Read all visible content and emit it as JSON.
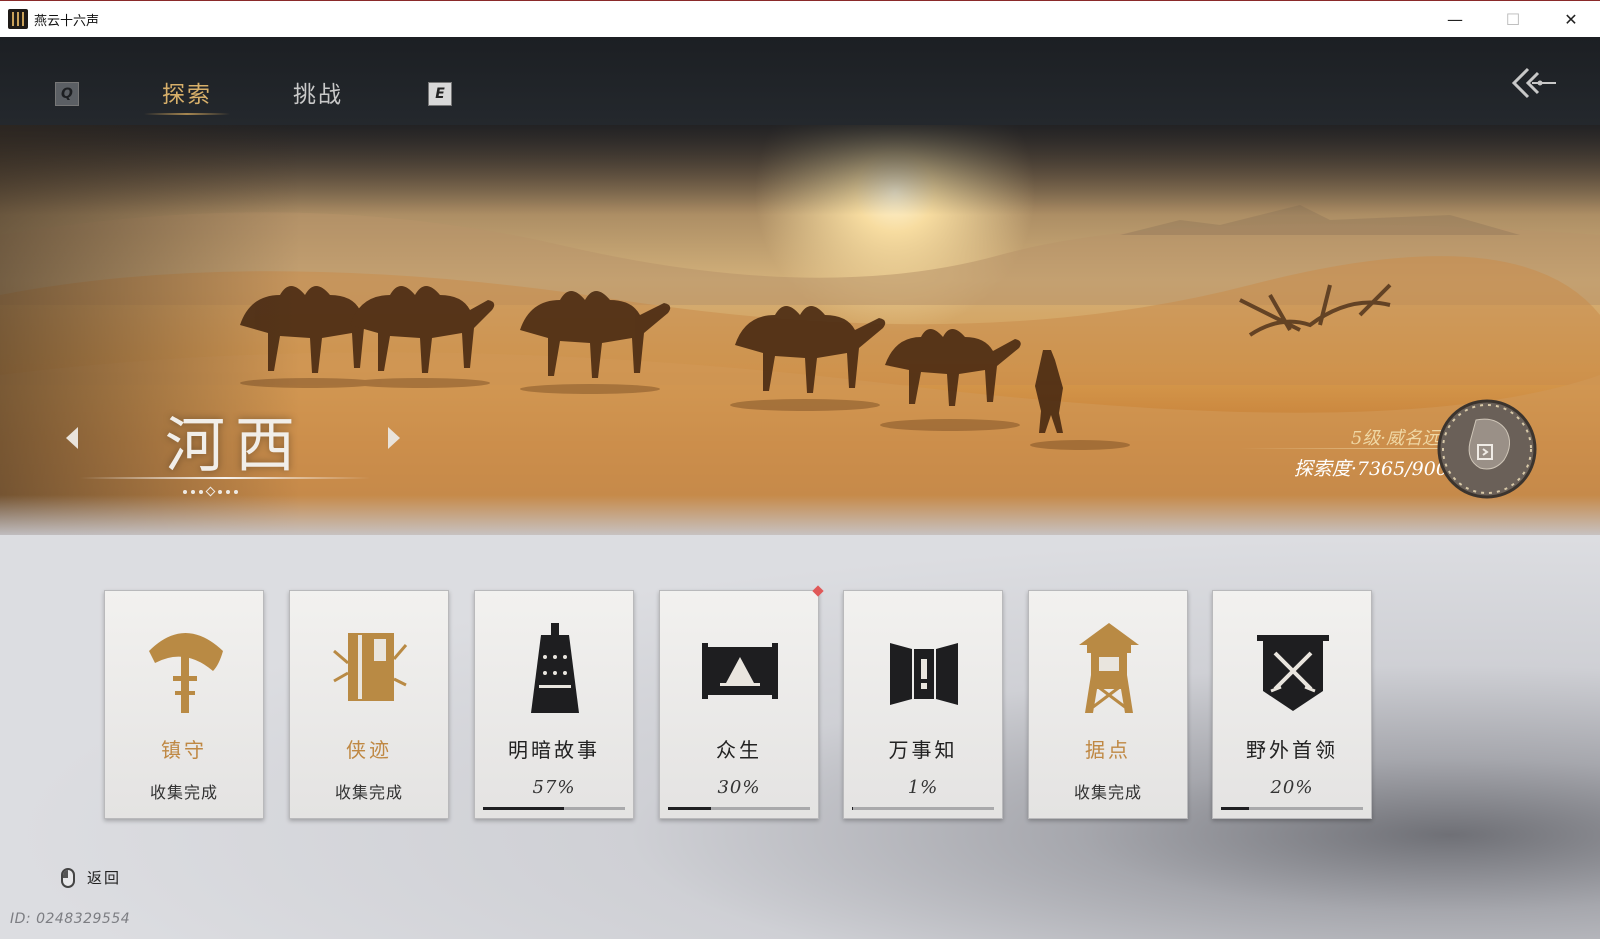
{
  "window": {
    "title": "燕云十六声",
    "controls": [
      "minimize-icon",
      "maximize-icon",
      "close-icon"
    ]
  },
  "header": {
    "key_left": "Q",
    "key_right": "E",
    "tabs": [
      {
        "label": "探索",
        "active": true
      },
      {
        "label": "挑战",
        "active": false
      }
    ],
    "accent_color": "#d8b06a"
  },
  "banner": {
    "region": "河西",
    "level": "5级·威名远扬",
    "exploration": "探索度·7365/9000"
  },
  "cards": [
    {
      "title": "镇守",
      "gold": true,
      "status": "收集完成",
      "icon": "bamboo-hat-icon"
    },
    {
      "title": "侠迹",
      "gold": true,
      "status": "收集完成",
      "icon": "book-icon"
    },
    {
      "title": "明暗故事",
      "gold": false,
      "status": "57%",
      "progress": 57,
      "icon": "bell-icon"
    },
    {
      "title": "众生",
      "gold": false,
      "status": "30%",
      "progress": 30,
      "icon": "scroll-painting-icon",
      "notify": true
    },
    {
      "title": "万事知",
      "gold": false,
      "status": "1%",
      "progress": 1,
      "icon": "folding-screen-icon"
    },
    {
      "title": "据点",
      "gold": true,
      "status": "收集完成",
      "icon": "watchtower-icon"
    },
    {
      "title": "野外首领",
      "gold": false,
      "status": "20%",
      "progress": 20,
      "icon": "crossed-swords-banner-icon"
    }
  ],
  "footer": {
    "return_label": "返回",
    "uid": "ID: 0248329554"
  }
}
